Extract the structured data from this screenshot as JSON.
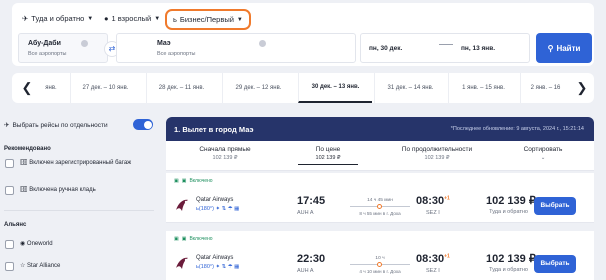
{
  "search": {
    "trip_type": "Туда и обратно",
    "passengers": "1 взрослый",
    "cabin_class": "Бизнес/Первый",
    "origin": {
      "city": "Абу-Даби",
      "sub": "Все аэропорты"
    },
    "destination": {
      "city": "Маэ",
      "sub": "Все аэропорты"
    },
    "depart_date": "пн, 30 дек.",
    "return_date": "пн, 13 янв.",
    "find_label": "Найти"
  },
  "date_tabs": [
    {
      "label": "янв."
    },
    {
      "label": "27 дек. – 10 янв."
    },
    {
      "label": "28 дек. – 11 янв."
    },
    {
      "label": "29 дек. – 12 янв."
    },
    {
      "label": "30 дек. – 13 янв."
    },
    {
      "label": "31 дек. – 14 янв."
    },
    {
      "label": "1 янв. – 15 янв."
    },
    {
      "label": "2 янв. – 16"
    }
  ],
  "filters": {
    "separate_label": "Выбрать рейсы по отдельности",
    "recommended_heading": "Рекомендовано",
    "recommended": [
      {
        "label": "Включен зарегистрированный багаж"
      },
      {
        "label": "Включена ручная кладь"
      }
    ],
    "alliance_heading": "Альянс",
    "alliances": [
      {
        "label": "Oneworld"
      },
      {
        "label": "Star Alliance"
      }
    ]
  },
  "results": {
    "title": "1. Вылет в город Маэ",
    "updated": "*Последнее обновление: 9 августа, 2024 г., 15:21:14",
    "sort": [
      {
        "label": "Сначала прямые",
        "price": "102 139 ₽"
      },
      {
        "label": "По цене",
        "price": "102 139 ₽"
      },
      {
        "label": "По продолжительности",
        "price": "102 139 ₽"
      },
      {
        "label": "Сортировать",
        "price": ""
      }
    ],
    "flights": [
      {
        "badge": "Включено",
        "airline": "Qatar Airways",
        "amenities": "(180°)",
        "depart": "17:45",
        "depart_code": "AUH A",
        "duration": "14 ч 45 мин",
        "stop_info": "8 ч 55 мин в г. Доха",
        "arrive": "08:30",
        "arrive_plus": "+1",
        "arrive_code": "SEZ I",
        "price": "102 139 ₽",
        "price_note": "Туда и обратно",
        "select_label": "Выбрать"
      },
      {
        "badge": "Включено",
        "airline": "Qatar Airways",
        "amenities": "(180°)",
        "depart": "22:30",
        "depart_code": "AUH A",
        "duration": "10 ч",
        "stop_info": "4 ч 10 мин в г. Доха",
        "arrive": "08:30",
        "arrive_plus": "+1",
        "arrive_code": "SEZ I",
        "price": "102 139 ₽",
        "price_note": "Туда и обратно",
        "select_label": "Выбрать"
      }
    ]
  },
  "colors": {
    "accent": "#2f63d6",
    "highlight": "#f07a2c",
    "header": "#26346a"
  }
}
